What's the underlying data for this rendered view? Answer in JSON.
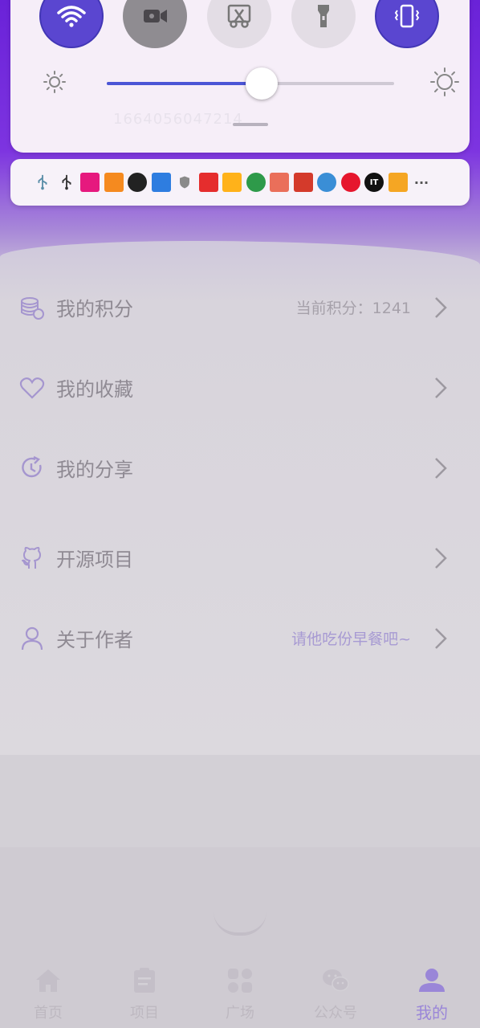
{
  "quick_settings": {
    "toggles": [
      {
        "name": "wifi-toggle",
        "icon": "wifi-icon",
        "state": "on"
      },
      {
        "name": "screen-record-toggle",
        "icon": "video-camera-icon",
        "state": "dark"
      },
      {
        "name": "screenshot-toggle",
        "icon": "scissors-icon",
        "state": "off"
      },
      {
        "name": "flashlight-toggle",
        "icon": "flashlight-icon",
        "state": "off"
      },
      {
        "name": "vibrate-toggle",
        "icon": "vibrate-icon",
        "state": "on"
      }
    ],
    "brightness_level": 0.54,
    "faint_text": "1664056047214"
  },
  "notification_icons": [
    {
      "icon": "usb-icon",
      "color": "#5a8ea8"
    },
    {
      "icon": "usb-icon",
      "color": "#333333"
    },
    {
      "icon": "app-icon-pink",
      "color": "#e6197e"
    },
    {
      "icon": "play-icon",
      "color": "#f58a1f"
    },
    {
      "icon": "camera-lens-icon",
      "color": "#222222"
    },
    {
      "icon": "zhihu-icon",
      "color": "#2e7de0"
    },
    {
      "icon": "shield-icon",
      "color": "#8a8a8a"
    },
    {
      "icon": "app-icon-red",
      "color": "#e52d2d"
    },
    {
      "icon": "app-icon-orange",
      "color": "#ffb21a"
    },
    {
      "icon": "chrome-icon",
      "color": "#2e9a4a"
    },
    {
      "icon": "jianshu-icon",
      "color": "#ea6f5a"
    },
    {
      "icon": "app-icon-red2",
      "color": "#d43a2b"
    },
    {
      "icon": "compass-icon",
      "color": "#3a8ed6"
    },
    {
      "icon": "weibo-icon",
      "color": "#e6162d"
    },
    {
      "icon": "ithome-icon",
      "color": "#111111"
    },
    {
      "icon": "app-icon-yellow",
      "color": "#f5a623"
    },
    {
      "icon": "more-icon",
      "color": "#555555"
    }
  ],
  "menu": {
    "items": [
      {
        "label": "我的积分",
        "extra": "当前积分：1241",
        "icon": "coins-icon"
      },
      {
        "label": "我的收藏",
        "extra": "",
        "icon": "heart-icon"
      },
      {
        "label": "我的分享",
        "extra": "",
        "icon": "share-icon"
      },
      {
        "label": "开源项目",
        "extra": "",
        "icon": "github-icon"
      },
      {
        "label": "关于作者",
        "extra": "请他吃份早餐吧~",
        "icon": "user-icon"
      }
    ]
  },
  "bottom_nav": {
    "tabs": [
      {
        "label": "首页",
        "icon": "home-icon"
      },
      {
        "label": "项目",
        "icon": "clipboard-icon"
      },
      {
        "label": "广场",
        "icon": "grid-icon"
      },
      {
        "label": "公众号",
        "icon": "wechat-icon"
      },
      {
        "label": "我的",
        "icon": "person-icon",
        "active": true
      }
    ]
  },
  "colors": {
    "accent": "#5a46d0",
    "purple_header": "#7d34e0",
    "active_tab": "#9a86d8"
  }
}
